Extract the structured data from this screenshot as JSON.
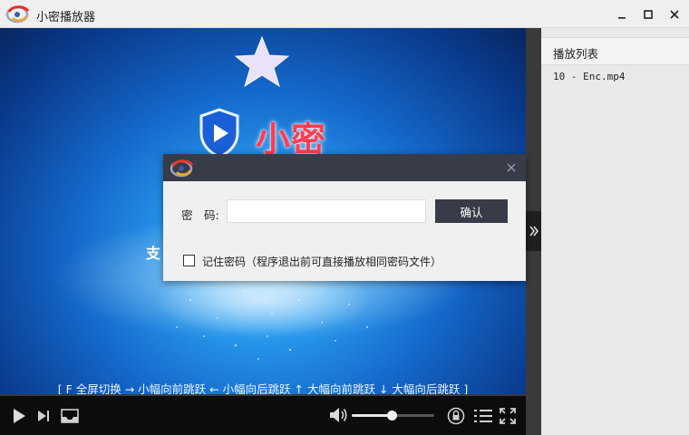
{
  "window": {
    "title": "小密播放器",
    "logo_icon": "app-logo-icon",
    "min_icon": "minimize-icon",
    "max_icon": "maximize-icon",
    "close_icon": "close-icon"
  },
  "video": {
    "brand_name": "小密",
    "feature_text": "支",
    "shortcut_hint": "[ F 全屏切换 → 小幅向前跳跃 ← 小幅向后跳跃 ↑ 大幅向前跳跃 ↓ 大幅向后跳跃 ]"
  },
  "controls": {
    "volume_level": 0.48,
    "icons": [
      "play-icon",
      "next-icon",
      "open-file-icon",
      "volume-icon",
      "lock-icon",
      "playlist-icon",
      "fullscreen-icon"
    ]
  },
  "playlist": {
    "title": "播放列表",
    "items": [
      "10 - Enc.mp4"
    ]
  },
  "dialog": {
    "password_label": "密　码:",
    "password_value": "",
    "confirm_label": "确认",
    "remember_label": "记住密码（程序退出前可直接播放相同密码文件）",
    "remember_checked": false
  },
  "colors": {
    "dialog_header": "#373c48",
    "brand_red": "#ff3d4f",
    "control_bar": "#0c0c0c"
  }
}
